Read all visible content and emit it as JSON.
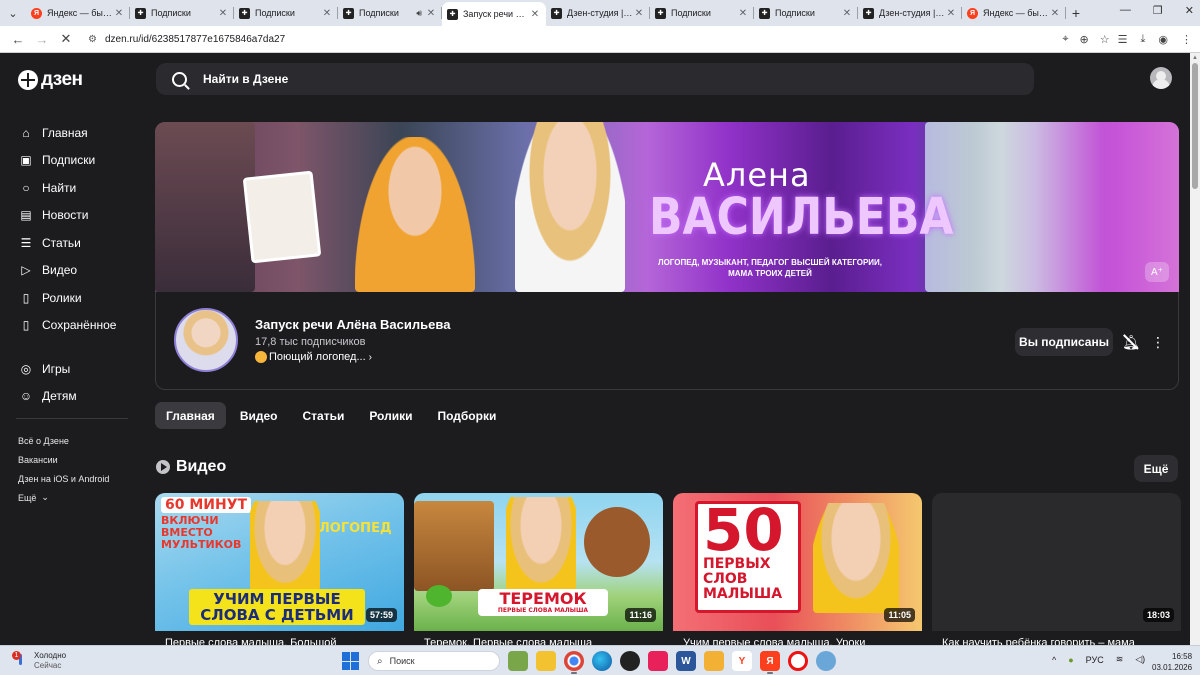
{
  "browser": {
    "tabs": [
      {
        "title": "Яндекс — быстрый",
        "favicon": "yandex-icon",
        "active": false
      },
      {
        "title": "Подписки",
        "favicon": "dzen-icon",
        "active": false
      },
      {
        "title": "Подписки",
        "favicon": "dzen-icon",
        "active": false
      },
      {
        "title": "Подписки",
        "favicon": "dzen-icon",
        "active": false,
        "audio": true
      },
      {
        "title": "Запуск речи Алё",
        "favicon": "dzen-icon",
        "active": true
      },
      {
        "title": "Дзен-студия | Тво",
        "favicon": "dzen-icon",
        "active": false
      },
      {
        "title": "Подписки",
        "favicon": "dzen-icon",
        "active": false
      },
      {
        "title": "Подписки",
        "favicon": "dzen-icon",
        "active": false
      },
      {
        "title": "Дзен-студия | И о",
        "favicon": "dzen-icon",
        "active": false
      },
      {
        "title": "Яндекс — быстро",
        "favicon": "yandex-icon",
        "active": false
      }
    ],
    "url": "dzen.ru/id/6238517877e1675846a7da27"
  },
  "header": {
    "logo_text": "дзен",
    "search_placeholder": "Найти в Дзене"
  },
  "sidebar": {
    "items": [
      {
        "label": "Главная",
        "icon": "home-icon"
      },
      {
        "label": "Подписки",
        "icon": "subscriptions-icon"
      },
      {
        "label": "Найти",
        "icon": "search-icon"
      },
      {
        "label": "Новости",
        "icon": "news-icon"
      },
      {
        "label": "Статьи",
        "icon": "articles-icon"
      },
      {
        "label": "Видео",
        "icon": "video-icon"
      },
      {
        "label": "Ролики",
        "icon": "shorts-icon"
      },
      {
        "label": "Сохранённое",
        "icon": "bookmark-icon"
      }
    ],
    "items2": [
      {
        "label": "Игры",
        "icon": "games-icon"
      },
      {
        "label": "Детям",
        "icon": "kids-icon"
      }
    ],
    "links": [
      "Всё о Дзене",
      "Вакансии",
      "Дзен на iOS и Android",
      "Ещё"
    ]
  },
  "banner": {
    "name": "Алена",
    "surname": "ВАСИЛЬЕВА",
    "desc_line1": "ЛОГОПЕД, МУЗЫКАНТ, ПЕДАГОГ ВЫСШЕЙ КАТЕГОРИИ,",
    "desc_line2": "МАМА ТРОИХ ДЕТЕЙ",
    "font_button": "A⁺"
  },
  "channel": {
    "name": "Запуск речи Алёна Васильева",
    "subscribers": "17,8 тыс подписчиков",
    "description": "Поющий логопед...",
    "subscribe_label": "Вы подписаны"
  },
  "tabs": [
    "Главная",
    "Видео",
    "Статьи",
    "Ролики",
    "Подборки"
  ],
  "section": {
    "title": "Видео",
    "more_label": "Ещё"
  },
  "videos": [
    {
      "duration": "57:59",
      "title": "Первые слова малыша. Большой",
      "thumb_top": "60 МИНУТ",
      "thumb_mid": "ВКЛЮЧИ ВМЕСТО МУЛЬТИКОВ",
      "thumb_tag": "ЛОГОПЕД",
      "thumb_bottom": "УЧИМ ПЕРВЫЕ СЛОВА С ДЕТЬМИ"
    },
    {
      "duration": "11:16",
      "title": "Теремок. Первые слова малыша",
      "thumb_bottom": "ТЕРЕМОК",
      "thumb_sub": "ПЕРВЫЕ СЛОВА МАЛЫША"
    },
    {
      "duration": "11:05",
      "title": "Учим первые слова малыша. Уроки",
      "thumb_num": "50",
      "thumb_text": "ПЕРВЫХ СЛОВ МАЛЫША"
    },
    {
      "duration": "18:03",
      "title": "Как научить ребёнка говорить – мама"
    }
  ],
  "taskbar": {
    "weather_title": "Холодно",
    "weather_sub": "Сейчас",
    "weather_badge": "1",
    "search_label": "Поиск",
    "lang": "РУС",
    "time": "16:58",
    "date": "03.01.2026"
  },
  "colors": {
    "page_bg": "#1c1c1f",
    "surface": "#2b2b2f",
    "accent_purple": "#9132c9",
    "chip_active": "#3b3b3f"
  }
}
